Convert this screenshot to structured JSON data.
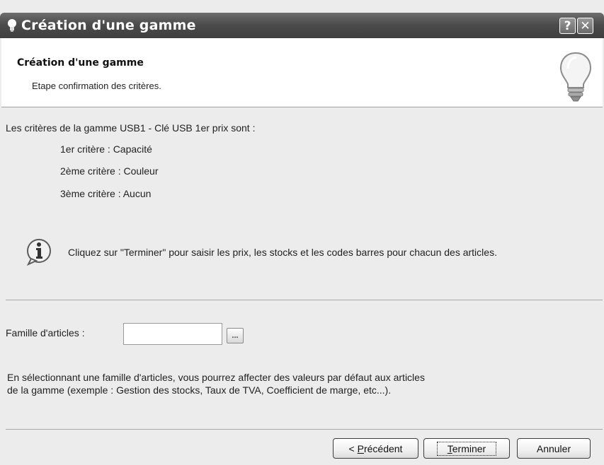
{
  "window": {
    "title": "Création d'une gamme",
    "help_label": "?",
    "close_label": "✕"
  },
  "header": {
    "title": "Création d'une gamme",
    "subtitle": "Etape confirmation des critères."
  },
  "criteria": {
    "intro": "Les critères de la gamme USB1 - Clé USB 1er prix sont :",
    "items": [
      "1er critère : Capacité",
      "2ème critère : Couleur",
      "3ème critère : Aucun"
    ]
  },
  "info": {
    "text": "Cliquez sur \"Terminer\" pour saisir les prix, les stocks et les codes barres pour chacun des articles."
  },
  "family": {
    "label": "Famille d'articles :",
    "value": "",
    "browse_label": "...",
    "hint_line1": "En sélectionnant une famille d'articles, vous pourrez affecter des valeurs par défaut aux articles",
    "hint_line2": "de la gamme (exemple : Gestion des stocks, Taux de TVA, Coefficient de marge, etc...)."
  },
  "buttons": {
    "previous_prefix": "< ",
    "previous_mnemonic": "P",
    "previous_rest": "récédent",
    "finish_mnemonic": "T",
    "finish_rest": "erminer",
    "cancel": "Annuler"
  },
  "icons": {
    "title": "lightbulb-icon",
    "header": "lightbulb-icon",
    "info": "info-icon"
  }
}
